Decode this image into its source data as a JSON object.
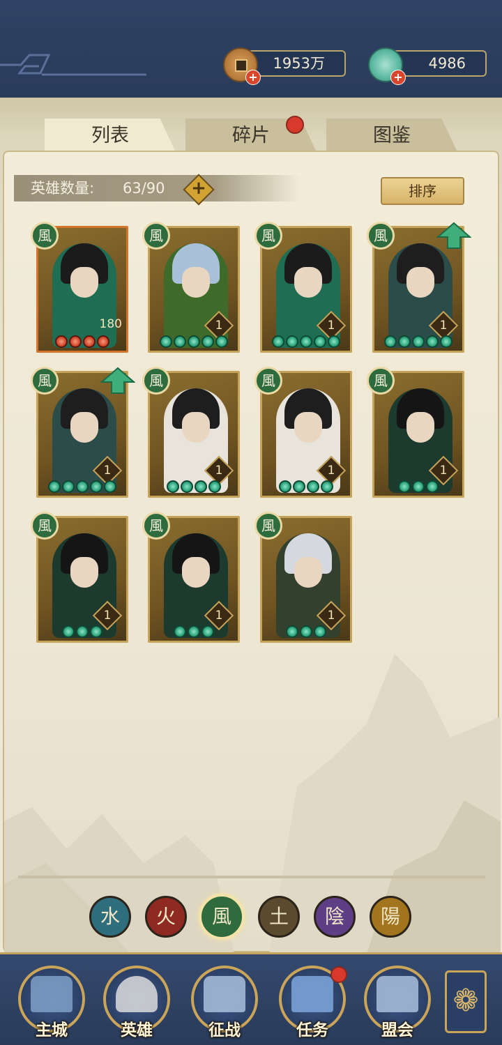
{
  "resources": {
    "coins": "1953万",
    "shells": "4986",
    "coin_icon": "copper-coin-icon",
    "shell_icon": "jade-shell-icon"
  },
  "tabs": [
    {
      "label": "列表",
      "active": true
    },
    {
      "label": "碎片",
      "active": false,
      "has_notification": true
    },
    {
      "label": "图鉴",
      "active": false
    }
  ],
  "hero_count": {
    "label": "英雄数量:",
    "value": "63/90"
  },
  "sort_button": "排序",
  "element_glyph": "風",
  "heroes": [
    {
      "level": "180",
      "stars": 4,
      "star_color": "red",
      "upgrade": false
    },
    {
      "level": "1",
      "stars": 5,
      "star_color": "green",
      "upgrade": false
    },
    {
      "level": "1",
      "stars": 5,
      "star_color": "green",
      "upgrade": false
    },
    {
      "level": "1",
      "stars": 5,
      "star_color": "green",
      "upgrade": true
    },
    {
      "level": "1",
      "stars": 5,
      "star_color": "green",
      "upgrade": true
    },
    {
      "level": "1",
      "stars": 4,
      "star_color": "green",
      "upgrade": false
    },
    {
      "level": "1",
      "stars": 4,
      "star_color": "green",
      "upgrade": false
    },
    {
      "level": "1",
      "stars": 3,
      "star_color": "green",
      "upgrade": false
    },
    {
      "level": "1",
      "stars": 3,
      "star_color": "green",
      "upgrade": false
    },
    {
      "level": "1",
      "stars": 3,
      "star_color": "green",
      "upgrade": false
    },
    {
      "level": "1",
      "stars": 3,
      "star_color": "green",
      "upgrade": false
    }
  ],
  "element_filters": [
    {
      "glyph": "水",
      "color": "#2f6f7d",
      "selected": false
    },
    {
      "glyph": "火",
      "color": "#8e2a22",
      "selected": false
    },
    {
      "glyph": "風",
      "color": "#2f6b3d",
      "selected": true
    },
    {
      "glyph": "土",
      "color": "#5b4a2e",
      "selected": false
    },
    {
      "glyph": "陰",
      "color": "#5e3f86",
      "selected": false
    },
    {
      "glyph": "陽",
      "color": "#a3741e",
      "selected": false
    }
  ],
  "nav": [
    {
      "label": "主城",
      "icon": "castle-icon"
    },
    {
      "label": "英雄",
      "icon": "hero-portrait-icon"
    },
    {
      "label": "征战",
      "icon": "war-drum-icon"
    },
    {
      "label": "任务",
      "icon": "scroll-bell-icon",
      "has_notification": true
    },
    {
      "label": "盟会",
      "icon": "pavilion-icon"
    }
  ],
  "menu_icon": "menu-flower-icon"
}
